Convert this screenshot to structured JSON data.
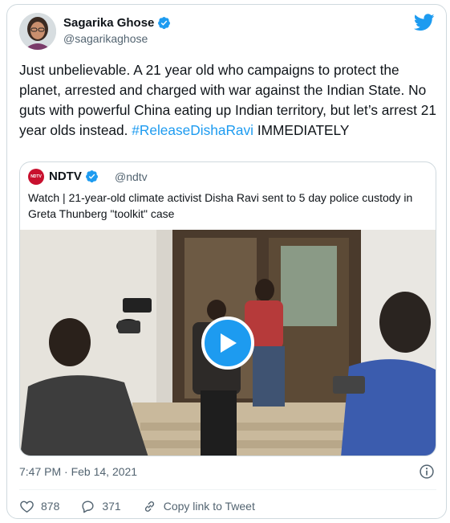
{
  "author": {
    "name": "Sagarika Ghose",
    "handle": "@sagarikaghose"
  },
  "tweet": {
    "text_before": "Just unbelievable. A 21 year old who campaigns to protect the planet, arrested and charged with war against the Indian State. No guts with powerful China eating up Indian territory, but let’s arrest 21 year olds instead. ",
    "hashtag": "#ReleaseDishaRavi",
    "text_after": " IMMEDIATELY"
  },
  "quoted": {
    "avatar_text": "NDTV",
    "name": "NDTV",
    "handle": "@ndtv",
    "text": "Watch | 21-year-old climate activist Disha Ravi sent to 5 day police custody in Greta Thunberg \"toolkit\" case"
  },
  "timestamp": "7:47 PM · Feb 14, 2021",
  "actions": {
    "likes": "878",
    "replies": "371",
    "copy_link": "Copy link to Tweet"
  },
  "colors": {
    "accent": "#1d9bf0",
    "text": "#0f1419",
    "muted": "#536471",
    "border": "#cfd9de"
  },
  "icons": [
    "verified-badge-icon",
    "twitter-bird-icon",
    "play-icon",
    "info-icon",
    "heart-icon",
    "reply-icon",
    "link-icon"
  ]
}
